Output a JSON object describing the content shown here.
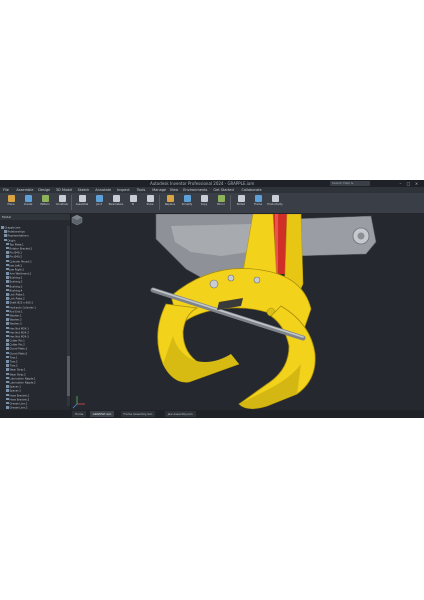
{
  "window": {
    "title": "Autodesk Inventor Professional 2024 - GRAPPLE.iam",
    "search_placeholder": "Search Help & Commands..."
  },
  "menu": [
    "File",
    "Assemble",
    "Design",
    "3D Model",
    "Sketch",
    "Annotate",
    "Inspect",
    "Tools",
    "Manage",
    "View",
    "Environments",
    "Get Started",
    "Collaborate"
  ],
  "ribbon": [
    {
      "label": "Place",
      "color": "#d9a441"
    },
    {
      "label": "Create",
      "color": "#5ea0d8"
    },
    {
      "label": "Pattern",
      "color": "#8fb35a"
    },
    {
      "label": "Constrain",
      "color": "#c9ced6"
    },
    {
      "label": "Assemble",
      "color": "#c9ced6"
    },
    {
      "label": "Joint",
      "color": "#5ea0d8"
    },
    {
      "label": "Parameters",
      "color": "#c9ced6"
    },
    {
      "label": "fx",
      "color": "#c9ced6"
    },
    {
      "label": "Show",
      "color": "#c9ced6"
    },
    {
      "label": "Replace",
      "color": "#d9a441"
    },
    {
      "label": "Simplify",
      "color": "#5ea0d8"
    },
    {
      "label": "Copy",
      "color": "#c9ced6"
    },
    {
      "label": "Mirror",
      "color": "#8fb35a"
    },
    {
      "label": "Bolted",
      "color": "#c9ced6"
    },
    {
      "label": "Frame",
      "color": "#5ea0d8"
    },
    {
      "label": "Productivity",
      "color": "#c9ced6"
    }
  ],
  "browser": {
    "title": "Model",
    "items": [
      "Grapple.iam",
      "Relationships",
      "Representations",
      "Origin",
      "Top Plate:1",
      "Rotator Bracket:1",
      "Pin Ø40:1",
      "Pin Ø40:2",
      "Cylinder Mount:1",
      "Jaw Left:1",
      "Jaw Right:1",
      "Arm Weldment:1",
      "Bushing:1",
      "Bushing:2",
      "Bushing:3",
      "Bushing:4",
      "Link Plate:1",
      "Link Plate:2",
      "Shaft Ø25 x 600:1",
      "Hydraulic Cylinder:1",
      "Rod End:1",
      "Washer:1",
      "Washer:2",
      "Washer:3",
      "Hex Nut M24:1",
      "Hex Nut M24:2",
      "Hex Nut M24:3",
      "Cotter Pin:1",
      "Cotter Pin:2",
      "Guard Plate:1",
      "Guard Plate:2",
      "Tine:1",
      "Tine:2",
      "Tine:3",
      "Wear Strip:1",
      "Wear Strip:2",
      "Lubrication Nipple:1",
      "Lubrication Nipple:2",
      "Spacer:1",
      "Spacer:2",
      "Hose Bracket:1",
      "Hose Bracket:2",
      "Grease Line:1",
      "Grease Line:2",
      "Stop Block:1",
      "Stop Block:2",
      "Sensor Mount:1",
      "Sensor Mount:2",
      "Cable Clamp:1",
      "Grapple Tip:1",
      "Grapple Tip:2",
      "Frame Assembly:1",
      "Jaw Assembly:1",
      "Hydraulic Assembly:1"
    ],
    "selected_index": 52
  },
  "tabs": [
    "Home",
    "GRAPPLE.iam",
    "Frame Assembly.iam",
    "Jaw Assembly.iam"
  ],
  "active_tab": 1,
  "colors": {
    "part_yellow": "#f2d21b",
    "part_shadow": "#b59a0c",
    "steel": "#8f9399",
    "red": "#d2302a"
  }
}
